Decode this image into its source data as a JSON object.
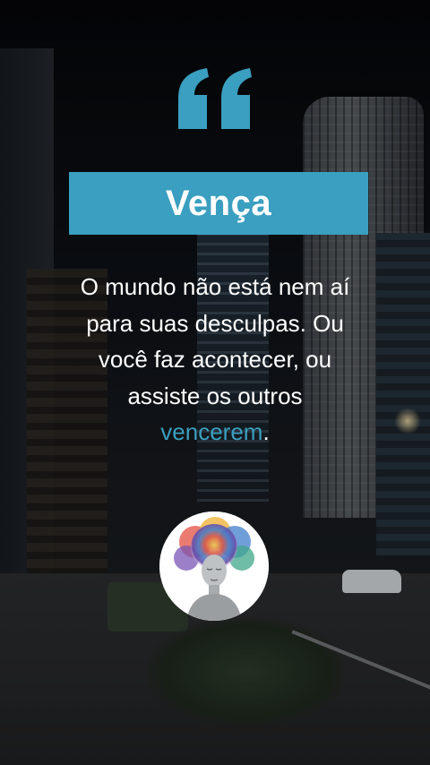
{
  "quote": {
    "title": "Vença",
    "body_lines": [
      "O mundo não está nem aí",
      "para suas desculpas. Ou",
      "você faz acontecer, ou",
      "assiste os outros"
    ],
    "highlight_word": "vencerem",
    "trailing_punct": "."
  },
  "icons": {
    "quote_mark": "quote-icon",
    "avatar": "avatar-colorful-brain-woman"
  },
  "colors": {
    "accent": "#3a9fc0",
    "text": "#ffffff"
  }
}
